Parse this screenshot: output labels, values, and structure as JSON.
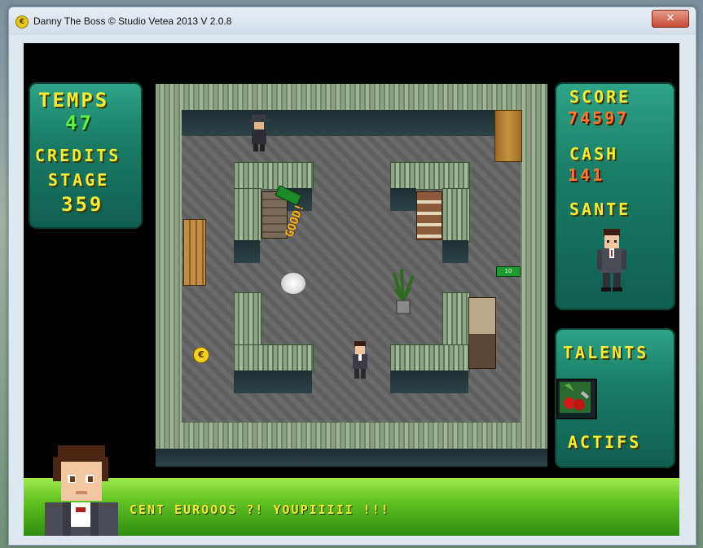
{
  "window": {
    "title": "Danny The Boss © Studio Vetea 2013 V 2.0.8",
    "icon_letter": "€",
    "close_glyph": "✕"
  },
  "hud_left": {
    "temps_label": "TEMPS",
    "temps_value": "47",
    "credits_label": "CREDITS",
    "stage_label": "STAGE",
    "stage_value": "359"
  },
  "hud_right": {
    "score_label": "SCORE",
    "score_value": "74597",
    "cash_label": "CASH",
    "cash_value": "141",
    "sante_label": "SANTE"
  },
  "talents": {
    "label": "TALENTS",
    "actifs_label": "ACTIFS"
  },
  "map": {
    "coin_symbol": "€",
    "bill_label": "10",
    "good_text": "GOOD!"
  },
  "dialog": {
    "text": "CENT EUROOOS ?! YOUPIIIII !!!"
  },
  "colors": {
    "hud_yellow": "#f4ec3a",
    "hud_green": "#5df04a",
    "hud_red": "#ff7a2e",
    "panel": "#1a7d66",
    "dialog_bar": "#63c222"
  }
}
